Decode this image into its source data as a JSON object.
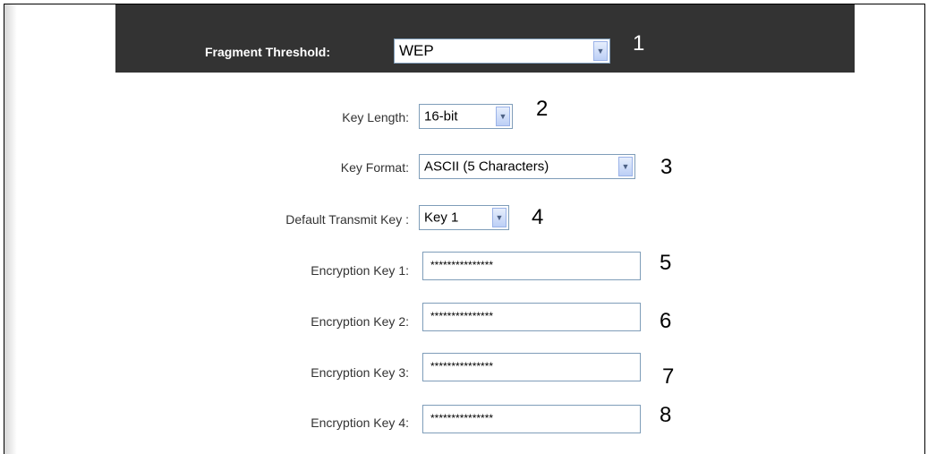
{
  "header": {
    "label": "Fragment Threshold:",
    "select_value": "WEP",
    "number": "1"
  },
  "fields": {
    "key_length": {
      "label": "Key Length:",
      "value": "16-bit",
      "number": "2"
    },
    "key_format": {
      "label": "Key Format:",
      "value": "ASCII (5 Characters)",
      "number": "3"
    },
    "default_key": {
      "label": "Default Transmit Key :",
      "value": "Key 1",
      "number": "4"
    },
    "enc_key_1": {
      "label": "Encryption Key 1:",
      "value": "***************",
      "number": "5"
    },
    "enc_key_2": {
      "label": "Encryption Key 2:",
      "value": "***************",
      "number": "6"
    },
    "enc_key_3": {
      "label": "Encryption Key 3:",
      "value": "***************",
      "number": "7"
    },
    "enc_key_4": {
      "label": "Encryption Key 4:",
      "value": "***************",
      "number": "8"
    }
  },
  "colors": {
    "header_bg": "#333333",
    "field_border": "#7f9db9",
    "label_text": "#333333"
  },
  "icons": {
    "dropdown": "chevron-down-icon"
  }
}
